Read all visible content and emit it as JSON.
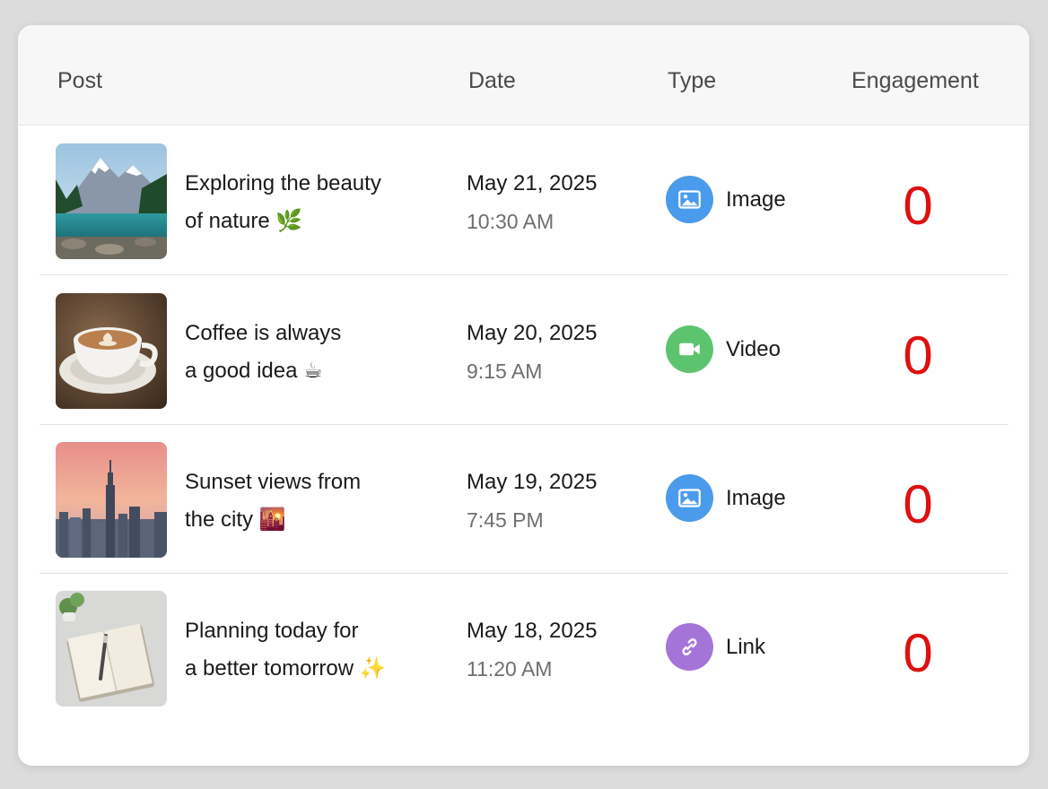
{
  "header": {
    "post": "Post",
    "date": "Date",
    "type": "Type",
    "engagement": "Engagement"
  },
  "rows": [
    {
      "title_line1": "Exploring the beauty",
      "title_line2": "of nature 🌿",
      "date": "May 21, 2025",
      "time": "10:30 AM",
      "type": "Image",
      "type_icon": "image-icon",
      "type_color": "#4a9bec",
      "engagement": "0",
      "thumbnail": "mountain-lake-thumbnail"
    },
    {
      "title_line1": "Coffee is always",
      "title_line2": "a good idea ☕",
      "date": "May 20, 2025",
      "time": "9:15 AM",
      "type": "Video",
      "type_icon": "video-camera-icon",
      "type_color": "#5cc46f",
      "engagement": "0",
      "thumbnail": "coffee-cup-thumbnail"
    },
    {
      "title_line1": "Sunset views from",
      "title_line2": "the city 🌇",
      "date": "May 19, 2025",
      "time": "7:45 PM",
      "type": "Image",
      "type_icon": "image-icon",
      "type_color": "#4a9bec",
      "engagement": "0",
      "thumbnail": "city-sunset-thumbnail"
    },
    {
      "title_line1": "Planning today for",
      "title_line2": "a better tomorrow ✨",
      "date": "May 18, 2025",
      "time": "11:20 AM",
      "type": "Link",
      "type_icon": "link-icon",
      "type_color": "#a574d8",
      "engagement": "0",
      "thumbnail": "notebook-thumbnail"
    }
  ],
  "colors": {
    "engagement": "#e01010",
    "header_bg": "#f7f7f7"
  }
}
